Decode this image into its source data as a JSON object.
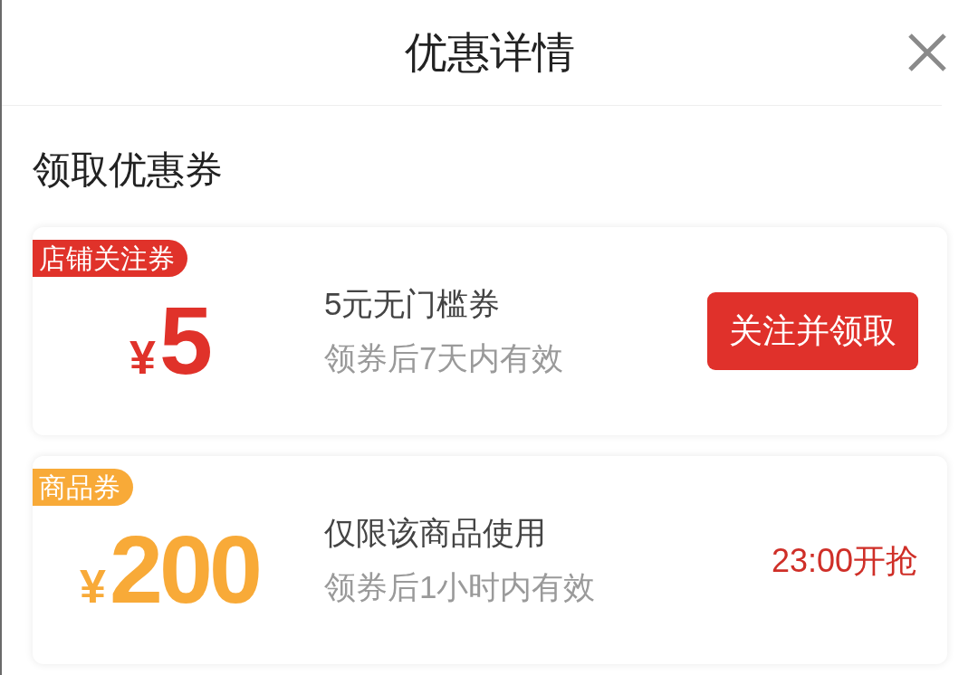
{
  "header": {
    "title": "优惠详情"
  },
  "section_title": "领取优惠券",
  "coupons": [
    {
      "tag": "店铺关注券",
      "color": "#e0322a",
      "currency": "¥",
      "amount": "5",
      "title": "5元无门槛券",
      "validity": "领券后7天内有效",
      "action": {
        "kind": "button",
        "label": "关注并领取"
      }
    },
    {
      "tag": "商品券",
      "color": "#f8aa38",
      "currency": "¥",
      "amount": "200",
      "title": "仅限该商品使用",
      "validity": "领券后1小时内有效",
      "action": {
        "kind": "notice",
        "label": "23:00开抢"
      }
    }
  ]
}
